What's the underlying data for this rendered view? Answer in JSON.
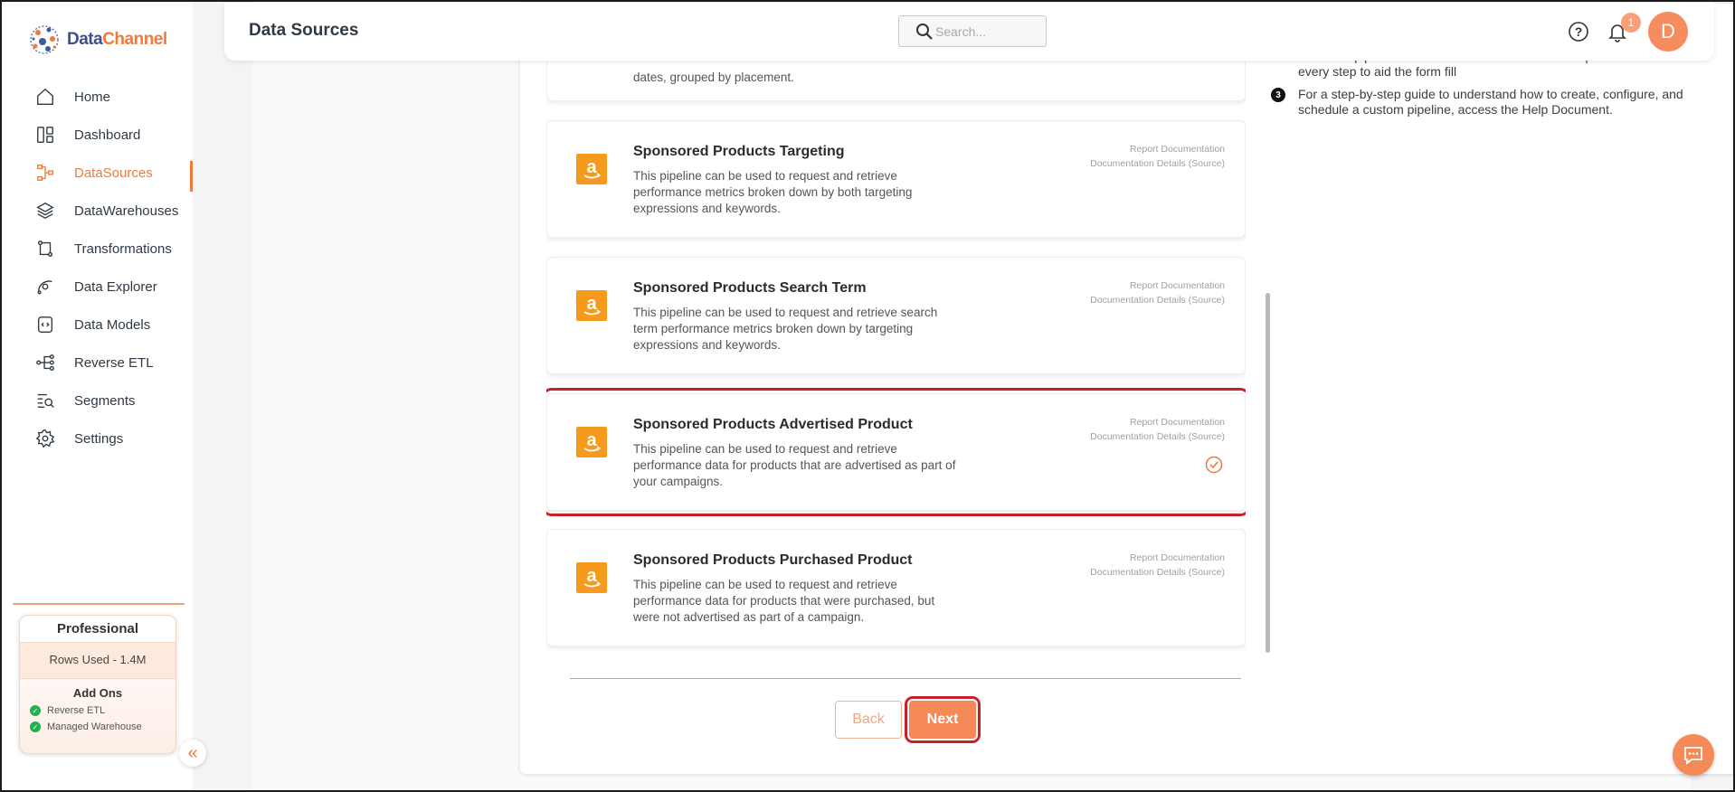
{
  "brand": {
    "name_part1": "Data",
    "name_part2": "Channel"
  },
  "header": {
    "title": "Data Sources",
    "search_placeholder": "Search...",
    "notification_count": "1",
    "avatar_initial": "D"
  },
  "sidebar": {
    "items": [
      {
        "label": "Home",
        "icon": "home-icon",
        "active": false
      },
      {
        "label": "Dashboard",
        "icon": "dashboard-icon",
        "active": false
      },
      {
        "label": "DataSources",
        "icon": "datasources-icon",
        "active": true
      },
      {
        "label": "DataWarehouses",
        "icon": "layers-icon",
        "active": false
      },
      {
        "label": "Transformations",
        "icon": "transformations-icon",
        "active": false
      },
      {
        "label": "Data Explorer",
        "icon": "explorer-icon",
        "active": false
      },
      {
        "label": "Data Models",
        "icon": "data-models-icon",
        "active": false
      },
      {
        "label": "Reverse ETL",
        "icon": "reverse-etl-icon",
        "active": false
      },
      {
        "label": "Segments",
        "icon": "segments-icon",
        "active": false
      },
      {
        "label": "Settings",
        "icon": "gear-icon",
        "active": false
      }
    ],
    "plan": {
      "title": "Professional",
      "rows_used": "Rows Used - 1.4M",
      "addons_title": "Add Ons",
      "addons": [
        "Reverse ETL",
        "Managed Warehouse"
      ]
    }
  },
  "pipelines": {
    "partial_desc": "dates, grouped by placement.",
    "cards": [
      {
        "title": "Sponsored Products Targeting",
        "desc": "This pipeline can be used to request and retrieve performance metrics broken down by both targeting expressions and keywords.",
        "link1": "Report Documentation",
        "link2": "Documentation Details (Source)",
        "selected": false
      },
      {
        "title": "Sponsored Products Search Term",
        "desc": "This pipeline can be used to request and retrieve search term performance metrics broken down by targeting expressions and keywords.",
        "link1": "Report Documentation",
        "link2": "Documentation Details (Source)",
        "selected": false
      },
      {
        "title": "Sponsored Products Advertised Product",
        "desc": "This pipeline can be used to request and retrieve performance data for products that are advertised as part of your campaigns.",
        "link1": "Report Documentation",
        "link2": "Documentation Details (Source)",
        "selected": true
      },
      {
        "title": "Sponsored Products Purchased Product",
        "desc": "This pipeline can be used to request and retrieve performance data for products that were purchased, but were not advertised as part of a campaign.",
        "link1": "Report Documentation",
        "link2": "Documentation Details (Source)",
        "selected": false
      }
    ]
  },
  "buttons": {
    "back": "Back",
    "next": "Next"
  },
  "instructions": {
    "partial_line1": "name the pipeline. Detailed instructions have been provided at",
    "partial_line2": "every step to aid the form fill",
    "step3_number": "3",
    "step3_text": "For a step-by-step guide to understand how to create, configure, and schedule a custom pipeline, access the Help Document."
  },
  "colors": {
    "accent": "#f58a58",
    "selection_outline": "#c8202a",
    "amazon_orange": "#f59a1c"
  }
}
